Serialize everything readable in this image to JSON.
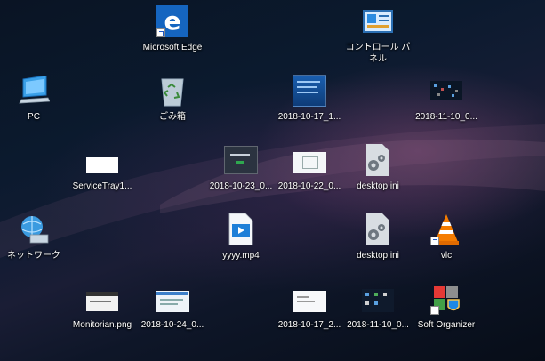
{
  "desktop": {
    "icons": [
      {
        "id": "edge",
        "label": "Microsoft Edge",
        "icon": "edge-icon"
      },
      {
        "id": "control-panel",
        "label": "コントロール パ\nネル",
        "icon": "control-panel-icon"
      },
      {
        "id": "pc",
        "label": "PC",
        "icon": "pc-icon"
      },
      {
        "id": "recycle-bin",
        "label": "ごみ箱",
        "icon": "recycle-bin-icon"
      },
      {
        "id": "file-20181017-1",
        "label": "2018-10-17_1...",
        "icon": "image-thumbnail-icon"
      },
      {
        "id": "file-20181110-1",
        "label": "2018-11-10_0...",
        "icon": "image-thumbnail-icon"
      },
      {
        "id": "servicetray",
        "label": "ServiceTray1...",
        "icon": "image-thumbnail-icon"
      },
      {
        "id": "file-20181023",
        "label": "2018-10-23_0...",
        "icon": "image-thumbnail-icon"
      },
      {
        "id": "file-20181022",
        "label": "2018-10-22_0...",
        "icon": "image-thumbnail-icon"
      },
      {
        "id": "desktop-ini-1",
        "label": "desktop.ini",
        "icon": "settings-file-icon"
      },
      {
        "id": "network",
        "label": "ネットワーク",
        "icon": "network-icon"
      },
      {
        "id": "yyyy-mp4",
        "label": "yyyy.mp4",
        "icon": "video-file-icon"
      },
      {
        "id": "desktop-ini-2",
        "label": "desktop.ini",
        "icon": "settings-file-icon"
      },
      {
        "id": "vlc",
        "label": "vlc",
        "icon": "vlc-icon"
      },
      {
        "id": "monitorian",
        "label": "Monitorian.png",
        "icon": "image-thumbnail-icon"
      },
      {
        "id": "file-20181024",
        "label": "2018-10-24_0...",
        "icon": "image-thumbnail-icon"
      },
      {
        "id": "file-20181017-2",
        "label": "2018-10-17_2...",
        "icon": "image-thumbnail-icon"
      },
      {
        "id": "file-20181110-2",
        "label": "2018-11-10_0...",
        "icon": "image-thumbnail-icon"
      },
      {
        "id": "soft-organizer",
        "label": "Soft Organizer",
        "icon": "soft-organizer-icon"
      }
    ]
  },
  "colors": {
    "accent": "#1e7fd8",
    "edge_blue": "#1565c0",
    "vlc_orange": "#f57c00"
  }
}
